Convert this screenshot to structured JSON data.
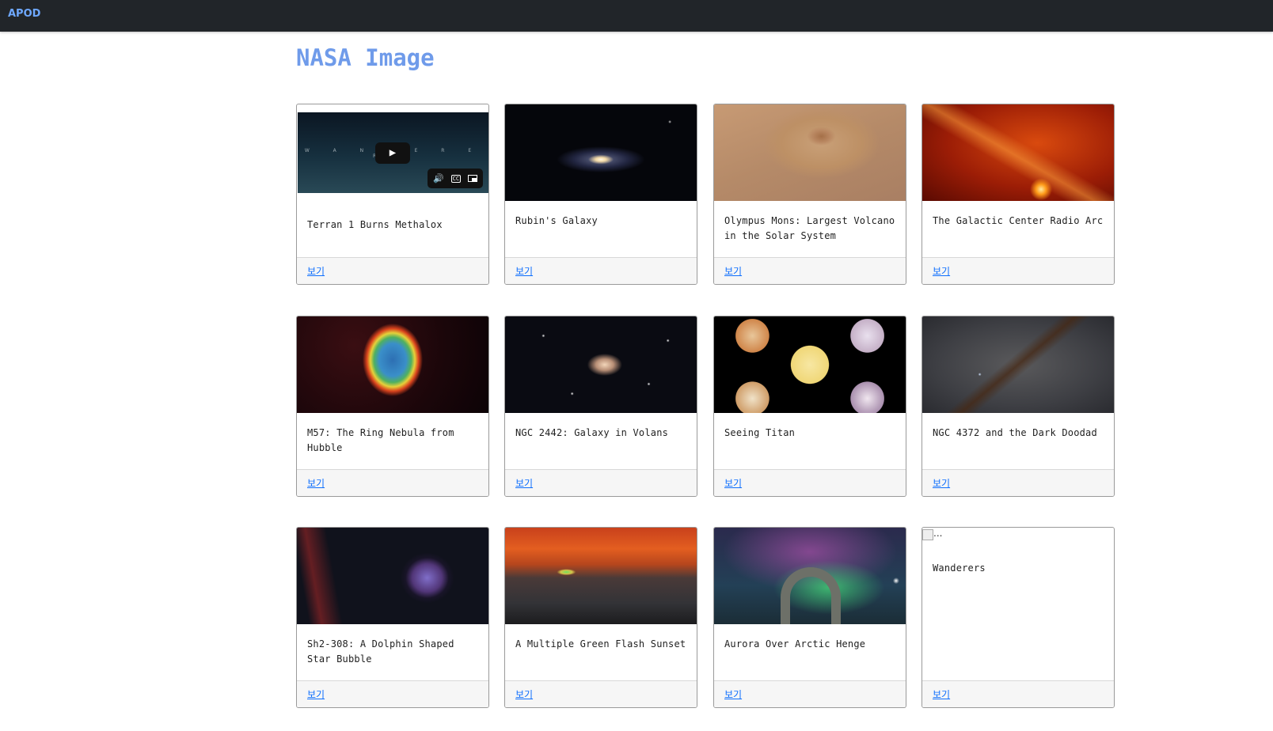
{
  "navbar": {
    "brand": "APOD"
  },
  "page": {
    "title": "NASA Image"
  },
  "cards": [
    {
      "title": "Terran 1 Burns Methalox",
      "link": "보기",
      "media": "video",
      "video_overlay_text": "W A N D E R E R S",
      "controls": [
        "volume-icon",
        "captions-icon",
        "pip-icon"
      ]
    },
    {
      "title": "Rubin's Galaxy",
      "link": "보기",
      "media": "image"
    },
    {
      "title": "Olympus Mons: Largest Volcano in the Solar System",
      "link": "보기",
      "media": "image"
    },
    {
      "title": "The Galactic Center Radio Arc",
      "link": "보기",
      "media": "image"
    },
    {
      "title": "M57: The Ring Nebula from Hubble",
      "link": "보기",
      "media": "image"
    },
    {
      "title": "NGC 2442: Galaxy in Volans",
      "link": "보기",
      "media": "image"
    },
    {
      "title": "Seeing Titan",
      "link": "보기",
      "media": "image"
    },
    {
      "title": "NGC 4372 and the Dark Doodad",
      "link": "보기",
      "media": "image"
    },
    {
      "title": "Sh2-308: A Dolphin Shaped Star Bubble",
      "link": "보기",
      "media": "image"
    },
    {
      "title": "A Multiple Green Flash Sunset",
      "link": "보기",
      "media": "image"
    },
    {
      "title": "Aurora Over Arctic Henge",
      "link": "보기",
      "media": "image"
    },
    {
      "title": "Wanderers",
      "link": "보기",
      "media": "broken-image",
      "alt": "..."
    }
  ],
  "colors": {
    "navbar_bg": "#212529",
    "brand": "#6ea8fe",
    "title": "#6f9bea",
    "link": "#0d6efd"
  }
}
